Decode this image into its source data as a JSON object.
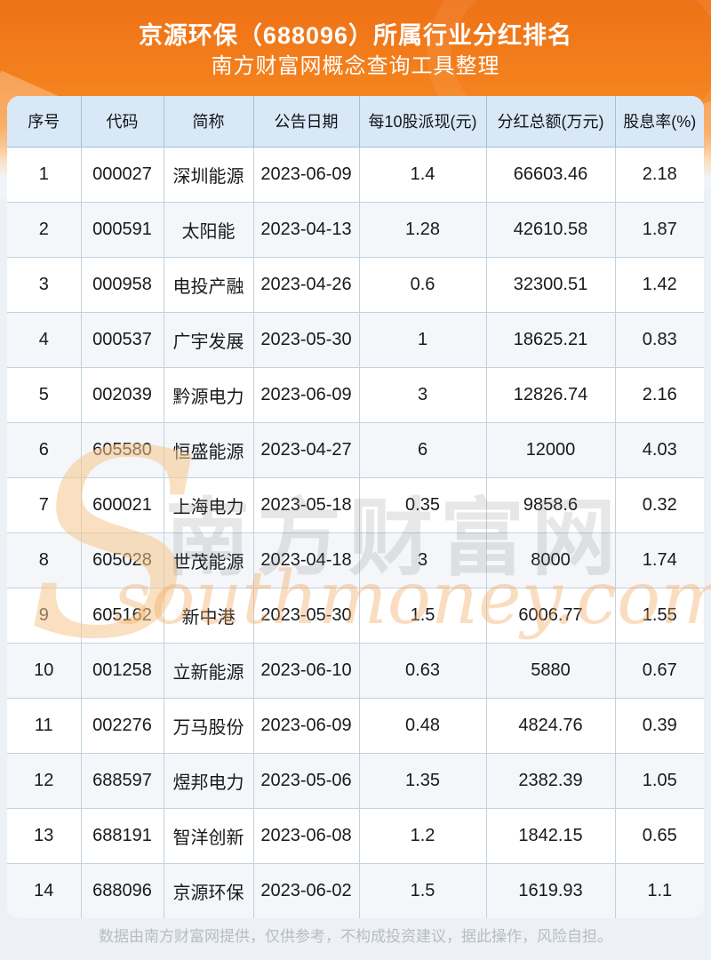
{
  "header": {
    "title": "京源环保（688096）所属行业分红排名",
    "subtitle": "南方财富网概念查询工具整理"
  },
  "chart_data": {
    "type": "table",
    "title": "京源环保（688096）所属行业分红排名",
    "subtitle": "南方财富网概念查询工具整理",
    "columns": [
      "序号",
      "代码",
      "简称",
      "公告日期",
      "每10股派现(元)",
      "分红总额(万元)",
      "股息率(%)"
    ],
    "rows": [
      [
        "1",
        "000027",
        "深圳能源",
        "2023-06-09",
        "1.4",
        "66603.46",
        "2.18"
      ],
      [
        "2",
        "000591",
        "太阳能",
        "2023-04-13",
        "1.28",
        "42610.58",
        "1.87"
      ],
      [
        "3",
        "000958",
        "电投产融",
        "2023-04-26",
        "0.6",
        "32300.51",
        "1.42"
      ],
      [
        "4",
        "000537",
        "广宇发展",
        "2023-05-30",
        "1",
        "18625.21",
        "0.83"
      ],
      [
        "5",
        "002039",
        "黔源电力",
        "2023-06-09",
        "3",
        "12826.74",
        "2.16"
      ],
      [
        "6",
        "605580",
        "恒盛能源",
        "2023-04-27",
        "6",
        "12000",
        "4.03"
      ],
      [
        "7",
        "600021",
        "上海电力",
        "2023-05-18",
        "0.35",
        "9858.6",
        "0.32"
      ],
      [
        "8",
        "605028",
        "世茂能源",
        "2023-04-18",
        "3",
        "8000",
        "1.74"
      ],
      [
        "9",
        "605162",
        "新中港",
        "2023-05-30",
        "1.5",
        "6006.77",
        "1.55"
      ],
      [
        "10",
        "001258",
        "立新能源",
        "2023-06-10",
        "0.63",
        "5880",
        "0.67"
      ],
      [
        "11",
        "002276",
        "万马股份",
        "2023-06-09",
        "0.48",
        "4824.76",
        "0.39"
      ],
      [
        "12",
        "688597",
        "煜邦电力",
        "2023-05-06",
        "1.35",
        "2382.39",
        "1.05"
      ],
      [
        "13",
        "688191",
        "智洋创新",
        "2023-06-08",
        "1.2",
        "1842.15",
        "0.65"
      ],
      [
        "14",
        "688096",
        "京源环保",
        "2023-06-02",
        "1.5",
        "1619.93",
        "1.1"
      ]
    ]
  },
  "watermark": {
    "logo_s": "S",
    "brand": "南方财富网",
    "domain": "southmoney.com"
  },
  "footer": {
    "disclaimer": "数据由南方财富网提供，仅供参考，不构成投资建议，据此操作，风险自担。"
  },
  "colors": {
    "banner_orange": "#f4811d",
    "header_cell_bg": "#d9e8f7",
    "row_alt_bg": "#f4f6f9",
    "border": "#c2d2e0",
    "page_bg": "#edf1f6",
    "footer_text": "#b7bcc5",
    "watermark_peach": "#f6c78c"
  }
}
